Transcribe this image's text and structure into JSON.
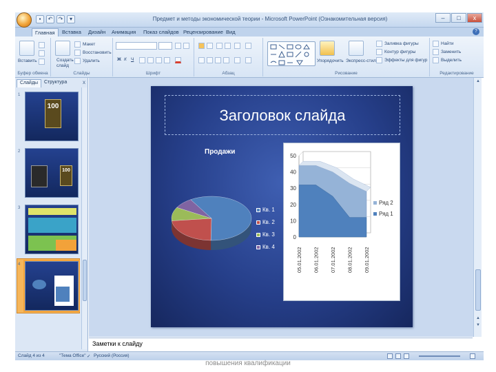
{
  "window": {
    "title": "Предмет и методы экономической теории - Microsoft PowerPoint (Ознакомительная версия)",
    "controls": [
      "–",
      "□",
      "x"
    ]
  },
  "ribbon_tabs": [
    "Главная",
    "Вставка",
    "Дизайн",
    "Анимация",
    "Показ слайдов",
    "Рецензирование",
    "Вид"
  ],
  "ribbon": {
    "clipboard": {
      "paste": "Вставить",
      "label": "Буфер обмена"
    },
    "slides": {
      "create": "Создать",
      "create2": "слайд",
      "layout": "Макет",
      "reset": "Восстановить",
      "delete": "Удалить",
      "label": "Слайды"
    },
    "font_label": "Шрифт",
    "paragraph_label": "Абзац",
    "drawing": {
      "arrange": "Упорядочить",
      "quick_styles": "Экспресс-стили",
      "fill": "Заливка фигуры",
      "outline": "Контур фигуры",
      "effects": "Эффекты для фигур",
      "label": "Рисование"
    },
    "editing": {
      "find": "Найти",
      "replace": "Заменить",
      "select": "Выделить",
      "label": "Редактирование"
    }
  },
  "left_pane": {
    "tabs": [
      "Слайды",
      "Структура"
    ],
    "close": "x",
    "slide_numbers": [
      "1",
      "2",
      "3",
      "4"
    ],
    "thumb1_big": "100",
    "thumb2_big": "100"
  },
  "slide": {
    "title": "Заголовок слайда",
    "pie_title": "Продажи",
    "pie_legend": [
      "Кв. 1",
      "Кв. 2",
      "Кв. 3",
      "Кв. 4"
    ],
    "area_legend": [
      "Ряд 2",
      "Ряд 1"
    ],
    "area_y_ticks": [
      "0",
      "10",
      "20",
      "30",
      "40",
      "50"
    ],
    "area_x_ticks": [
      "05.01.2002",
      "06.01.2002",
      "07.01.2002",
      "08.01.2002",
      "09.01.2002"
    ]
  },
  "chart_data": [
    {
      "type": "pie",
      "title": "Продажи",
      "categories": [
        "Кв. 1",
        "Кв. 2",
        "Кв. 3",
        "Кв. 4"
      ],
      "values": [
        59,
        23,
        10,
        8
      ],
      "colors": [
        "#4f81bd",
        "#c0504d",
        "#9bbb59",
        "#8064a2"
      ],
      "legend": "right"
    },
    {
      "type": "area",
      "categories": [
        "05.01.2002",
        "06.01.2002",
        "07.01.2002",
        "08.01.2002",
        "09.01.2002"
      ],
      "series": [
        {
          "name": "Ряд 1",
          "values": [
            32,
            32,
            25,
            12,
            12
          ]
        },
        {
          "name": "Ряд 2",
          "values": [
            12,
            12,
            15,
            21,
            16
          ]
        }
      ],
      "ylim": [
        0,
        50
      ],
      "legend": "right"
    }
  ],
  "notes": {
    "placeholder": "Заметки к слайду"
  },
  "status": {
    "slide": "Слайд 4 из 4",
    "theme": "\"Тема Office\"",
    "language": "Русский (Россия)"
  },
  "caption": "повышения квалификации"
}
